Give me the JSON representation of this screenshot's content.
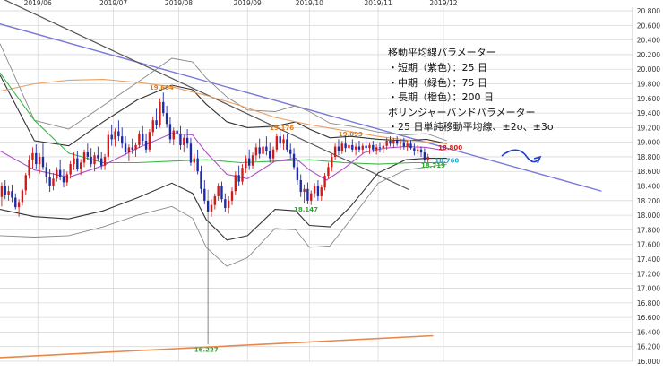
{
  "chart_data": {
    "type": "candlestick",
    "grid": true,
    "x_tick_labels": [
      "2019/06",
      "2019/07",
      "2019/08",
      "2019/09",
      "2019/10",
      "2019/11",
      "2019/12"
    ],
    "y_tick_labels": [
      "16.000",
      "16.200",
      "16.400",
      "16.600",
      "16.800",
      "17.000",
      "17.200",
      "17.400",
      "17.600",
      "17.800",
      "18.000",
      "18.200",
      "18.400",
      "18.600",
      "18.800",
      "19.000",
      "19.200",
      "19.400",
      "19.600",
      "19.800",
      "20.000",
      "20.200",
      "20.400",
      "20.600",
      "20.800"
    ],
    "ylim": [
      16.0,
      20.85
    ],
    "x_range": [
      0,
      184
    ],
    "colors": {
      "up": "#d11a1a",
      "down": "#1d2ba8",
      "sma25": "#b04fc8",
      "sma75": "#3cb84a",
      "sma200": "#e8a063",
      "bands": "#333333",
      "resistance_line": "#7b79d8",
      "steep_line": "#555555",
      "support_line": "#e8884a",
      "forecast_arrow": "#1d3fd0"
    },
    "annotation": {
      "lines": [
        "移動平均線パラメーター",
        "・短期（紫色）：25 日",
        "・中期（緑色）：75 日",
        "・長期（橙色）：200 日",
        "ボリンジャーバンドパラメーター",
        "・25 日単純移動平均線、±2σ、±3σ"
      ]
    },
    "price_labels": [
      {
        "text": "19.684",
        "x": 47,
        "y": 19.72,
        "color": "#e07b1a"
      },
      {
        "text": "19.176",
        "x": 82,
        "y": 19.17,
        "color": "#e07b1a"
      },
      {
        "text": "19.093",
        "x": 102,
        "y": 19.08,
        "color": "#e07b1a"
      },
      {
        "text": "18.147",
        "x": 89,
        "y": 18.05,
        "color": "#2fa52f"
      },
      {
        "text": "16.227",
        "x": 60,
        "y": 16.13,
        "color": "#2fa52f"
      },
      {
        "text": "18.719",
        "x": 126,
        "y": 18.65,
        "color": "#2fa52f"
      },
      {
        "text": "18.800",
        "x": 131,
        "y": 18.9,
        "color": "#d11a1a"
      },
      {
        "text": "18.760",
        "x": 130,
        "y": 18.72,
        "color": "#17a8c8"
      }
    ],
    "trendlines": [
      {
        "name": "resistance",
        "points": [
          [
            0,
            20.62
          ],
          [
            175,
            18.33
          ]
        ]
      },
      {
        "name": "steep",
        "points": [
          [
            0,
            20.98
          ],
          [
            119,
            18.35
          ]
        ]
      },
      {
        "name": "support",
        "points": [
          [
            0,
            16.05
          ],
          [
            126,
            16.35
          ]
        ]
      }
    ],
    "x_tick_positions": [
      11,
      33,
      52,
      72,
      90,
      110,
      129
    ],
    "candles": [
      [
        18.25,
        18.45,
        18.12,
        18.4
      ],
      [
        18.4,
        18.48,
        18.22,
        18.28
      ],
      [
        18.28,
        18.41,
        18.2,
        18.33
      ],
      [
        18.33,
        18.42,
        18.18,
        18.24
      ],
      [
        18.24,
        18.3,
        18.08,
        18.11
      ],
      [
        18.11,
        18.22,
        17.98,
        18.18
      ],
      [
        18.18,
        18.36,
        18.13,
        18.34
      ],
      [
        18.34,
        18.58,
        18.28,
        18.55
      ],
      [
        18.55,
        18.82,
        18.5,
        18.76
      ],
      [
        18.76,
        18.93,
        18.64,
        18.85
      ],
      [
        18.85,
        18.97,
        18.63,
        18.7
      ],
      [
        18.7,
        18.85,
        18.57,
        18.8
      ],
      [
        18.8,
        18.98,
        18.62,
        18.66
      ],
      [
        18.66,
        18.72,
        18.44,
        18.52
      ],
      [
        18.52,
        18.64,
        18.32,
        18.4
      ],
      [
        18.4,
        18.58,
        18.34,
        18.5
      ],
      [
        18.5,
        18.66,
        18.46,
        18.62
      ],
      [
        18.62,
        18.76,
        18.48,
        18.52
      ],
      [
        18.52,
        18.63,
        18.38,
        18.45
      ],
      [
        18.45,
        18.6,
        18.4,
        18.56
      ],
      [
        18.56,
        18.74,
        18.5,
        18.7
      ],
      [
        18.7,
        18.86,
        18.62,
        18.78
      ],
      [
        18.78,
        18.88,
        18.6,
        18.64
      ],
      [
        18.64,
        18.77,
        18.55,
        18.72
      ],
      [
        18.72,
        18.9,
        18.66,
        18.86
      ],
      [
        18.86,
        18.98,
        18.75,
        18.8
      ],
      [
        18.8,
        18.92,
        18.66,
        18.7
      ],
      [
        18.7,
        18.86,
        18.6,
        18.82
      ],
      [
        18.82,
        18.94,
        18.74,
        18.78
      ],
      [
        18.78,
        18.86,
        18.62,
        18.68
      ],
      [
        18.68,
        18.84,
        18.62,
        18.8
      ],
      [
        18.8,
        19.16,
        18.76,
        19.1
      ],
      [
        19.1,
        19.24,
        18.95,
        19.04
      ],
      [
        19.04,
        19.19,
        18.94,
        19.15
      ],
      [
        19.15,
        19.3,
        19.02,
        19.08
      ],
      [
        19.08,
        19.2,
        18.92,
        18.98
      ],
      [
        18.98,
        19.08,
        18.82,
        18.86
      ],
      [
        18.86,
        18.97,
        18.74,
        18.93
      ],
      [
        18.93,
        19.05,
        18.84,
        18.9
      ],
      [
        18.9,
        19.0,
        18.8,
        18.96
      ],
      [
        18.96,
        19.16,
        18.92,
        19.12
      ],
      [
        19.12,
        19.22,
        18.96,
        19.02
      ],
      [
        19.02,
        19.12,
        18.85,
        18.9
      ],
      [
        18.9,
        19.18,
        18.86,
        19.14
      ],
      [
        19.14,
        19.35,
        19.08,
        19.3
      ],
      [
        19.3,
        19.46,
        19.18,
        19.24
      ],
      [
        19.24,
        19.6,
        19.2,
        19.55
      ],
      [
        19.55,
        19.68,
        19.36,
        19.4
      ],
      [
        19.4,
        19.5,
        19.2,
        19.25
      ],
      [
        19.25,
        19.34,
        18.98,
        19.04
      ],
      [
        19.04,
        19.2,
        18.96,
        19.16
      ],
      [
        19.16,
        19.3,
        19.06,
        19.12
      ],
      [
        19.12,
        19.22,
        18.9,
        18.96
      ],
      [
        18.96,
        19.1,
        18.86,
        19.06
      ],
      [
        19.06,
        19.18,
        18.92,
        18.98
      ],
      [
        18.98,
        19.06,
        18.68,
        18.72
      ],
      [
        18.72,
        18.84,
        18.6,
        18.78
      ],
      [
        18.78,
        18.9,
        18.56,
        18.6
      ],
      [
        18.6,
        18.68,
        18.3,
        18.36
      ],
      [
        18.36,
        18.48,
        18.15,
        18.2
      ],
      [
        18.2,
        18.35,
        16.23,
        18.05
      ],
      [
        18.05,
        18.22,
        17.98,
        18.14
      ],
      [
        18.14,
        18.3,
        18.08,
        18.26
      ],
      [
        18.26,
        18.44,
        18.2,
        18.4
      ],
      [
        18.4,
        18.46,
        18.18,
        18.22
      ],
      [
        18.22,
        18.3,
        18.05,
        18.1
      ],
      [
        18.1,
        18.26,
        18.02,
        18.2
      ],
      [
        18.2,
        18.38,
        18.14,
        18.33
      ],
      [
        18.33,
        18.6,
        18.28,
        18.55
      ],
      [
        18.55,
        18.68,
        18.4,
        18.46
      ],
      [
        18.46,
        18.7,
        18.42,
        18.65
      ],
      [
        18.65,
        18.82,
        18.58,
        18.78
      ],
      [
        18.78,
        18.9,
        18.62,
        18.68
      ],
      [
        18.68,
        18.86,
        18.64,
        18.82
      ],
      [
        18.82,
        18.98,
        18.74,
        18.93
      ],
      [
        18.93,
        19.05,
        18.78,
        18.84
      ],
      [
        18.84,
        18.98,
        18.76,
        18.94
      ],
      [
        18.94,
        19.08,
        18.82,
        18.88
      ],
      [
        18.88,
        19.0,
        18.72,
        18.78
      ],
      [
        18.78,
        18.94,
        18.72,
        18.9
      ],
      [
        18.9,
        19.12,
        18.86,
        19.08
      ],
      [
        19.08,
        19.18,
        18.92,
        18.98
      ],
      [
        18.98,
        19.1,
        18.9,
        19.04
      ],
      [
        19.04,
        19.12,
        18.86,
        18.9
      ],
      [
        18.9,
        18.98,
        18.78,
        18.84
      ],
      [
        18.84,
        18.92,
        18.62,
        18.66
      ],
      [
        18.66,
        18.76,
        18.42,
        18.48
      ],
      [
        18.48,
        18.56,
        18.25,
        18.32
      ],
      [
        18.32,
        18.42,
        18.16,
        18.36
      ],
      [
        18.36,
        18.45,
        18.15,
        18.2
      ],
      [
        18.2,
        18.34,
        18.14,
        18.3
      ],
      [
        18.3,
        18.44,
        18.24,
        18.4
      ],
      [
        18.4,
        18.48,
        18.2,
        18.26
      ],
      [
        18.26,
        18.42,
        18.2,
        18.38
      ],
      [
        18.38,
        18.58,
        18.34,
        18.54
      ],
      [
        18.54,
        18.72,
        18.5,
        18.66
      ],
      [
        18.66,
        18.84,
        18.6,
        18.8
      ],
      [
        18.8,
        18.98,
        18.76,
        18.94
      ],
      [
        18.94,
        19.04,
        18.82,
        18.88
      ],
      [
        18.88,
        19.02,
        18.84,
        18.98
      ],
      [
        18.98,
        19.09,
        18.86,
        18.92
      ],
      [
        18.92,
        19.02,
        18.84,
        18.96
      ],
      [
        18.96,
        19.04,
        18.86,
        18.9
      ],
      [
        18.9,
        18.98,
        18.82,
        18.94
      ],
      [
        18.94,
        19.02,
        18.86,
        18.9
      ],
      [
        18.9,
        18.98,
        18.84,
        18.95
      ],
      [
        18.95,
        19.03,
        18.88,
        18.92
      ],
      [
        18.92,
        19.0,
        18.84,
        18.96
      ],
      [
        18.96,
        19.02,
        18.86,
        18.9
      ],
      [
        18.9,
        18.97,
        18.83,
        18.93
      ],
      [
        18.93,
        19.0,
        18.86,
        18.92
      ],
      [
        18.92,
        18.98,
        18.85,
        18.95
      ],
      [
        18.95,
        19.06,
        18.9,
        19.02
      ],
      [
        19.02,
        19.08,
        18.94,
        18.98
      ],
      [
        18.98,
        19.06,
        18.92,
        19.03
      ],
      [
        19.03,
        19.08,
        18.95,
        18.98
      ],
      [
        18.98,
        19.05,
        18.9,
        19.0
      ],
      [
        19.0,
        19.06,
        18.9,
        18.94
      ],
      [
        18.94,
        19.02,
        18.88,
        18.98
      ],
      [
        18.98,
        19.03,
        18.9,
        18.92
      ],
      [
        18.92,
        18.98,
        18.82,
        18.88
      ],
      [
        18.88,
        18.96,
        18.84,
        18.9
      ],
      [
        18.9,
        18.94,
        18.8,
        18.86
      ],
      [
        18.86,
        18.92,
        18.72,
        18.76
      ],
      [
        18.76,
        18.84,
        18.72,
        18.8
      ]
    ],
    "sma25": [
      [
        0,
        18.88
      ],
      [
        10,
        18.62
      ],
      [
        20,
        18.52
      ],
      [
        30,
        18.68
      ],
      [
        40,
        18.92
      ],
      [
        50,
        19.12
      ],
      [
        56,
        19.1
      ],
      [
        60,
        18.86
      ],
      [
        66,
        18.56
      ],
      [
        72,
        18.5
      ],
      [
        80,
        18.74
      ],
      [
        86,
        18.78
      ],
      [
        90,
        18.62
      ],
      [
        95,
        18.48
      ],
      [
        100,
        18.64
      ],
      [
        106,
        18.86
      ],
      [
        112,
        18.92
      ],
      [
        118,
        18.94
      ],
      [
        124,
        18.93
      ],
      [
        130,
        18.88
      ]
    ],
    "sma75": [
      [
        0,
        19.95
      ],
      [
        10,
        19.3
      ],
      [
        20,
        18.85
      ],
      [
        30,
        18.72
      ],
      [
        40,
        18.72
      ],
      [
        50,
        18.74
      ],
      [
        60,
        18.76
      ],
      [
        70,
        18.72
      ],
      [
        80,
        18.74
      ],
      [
        90,
        18.76
      ],
      [
        100,
        18.72
      ],
      [
        110,
        18.7
      ],
      [
        120,
        18.72
      ],
      [
        130,
        18.72
      ]
    ],
    "sma200": [
      [
        0,
        19.7
      ],
      [
        10,
        19.8
      ],
      [
        20,
        19.85
      ],
      [
        30,
        19.86
      ],
      [
        40,
        19.82
      ],
      [
        50,
        19.76
      ],
      [
        60,
        19.64
      ],
      [
        70,
        19.5
      ],
      [
        80,
        19.34
      ],
      [
        90,
        19.24
      ],
      [
        100,
        19.16
      ],
      [
        110,
        19.08
      ],
      [
        120,
        19.02
      ],
      [
        130,
        18.98
      ]
    ],
    "bands": {
      "upper3": [
        [
          0,
          20.35
        ],
        [
          10,
          19.3
        ],
        [
          20,
          19.18
        ],
        [
          30,
          19.5
        ],
        [
          40,
          19.82
        ],
        [
          50,
          20.15
        ],
        [
          56,
          20.1
        ],
        [
          60,
          19.88
        ],
        [
          66,
          19.62
        ],
        [
          72,
          19.44
        ],
        [
          80,
          19.42
        ],
        [
          86,
          19.5
        ],
        [
          90,
          19.42
        ],
        [
          96,
          19.26
        ],
        [
          102,
          19.22
        ],
        [
          110,
          19.14
        ],
        [
          118,
          19.1
        ],
        [
          124,
          19.12
        ],
        [
          130,
          19.02
        ]
      ],
      "upper2": [
        [
          0,
          19.92
        ],
        [
          10,
          19.02
        ],
        [
          20,
          18.95
        ],
        [
          30,
          19.28
        ],
        [
          40,
          19.58
        ],
        [
          50,
          19.78
        ],
        [
          56,
          19.72
        ],
        [
          60,
          19.52
        ],
        [
          66,
          19.28
        ],
        [
          72,
          19.2
        ],
        [
          80,
          19.22
        ],
        [
          86,
          19.28
        ],
        [
          90,
          19.18
        ],
        [
          96,
          19.06
        ],
        [
          102,
          19.08
        ],
        [
          110,
          19.04
        ],
        [
          118,
          19.02
        ],
        [
          124,
          19.04
        ],
        [
          130,
          18.98
        ]
      ],
      "lower2": [
        [
          0,
          18.08
        ],
        [
          10,
          17.98
        ],
        [
          20,
          17.95
        ],
        [
          30,
          18.06
        ],
        [
          40,
          18.24
        ],
        [
          50,
          18.44
        ],
        [
          56,
          18.3
        ],
        [
          60,
          17.94
        ],
        [
          66,
          17.66
        ],
        [
          72,
          17.72
        ],
        [
          80,
          18.08
        ],
        [
          86,
          18.06
        ],
        [
          90,
          17.86
        ],
        [
          96,
          17.84
        ],
        [
          102,
          18.12
        ],
        [
          110,
          18.58
        ],
        [
          118,
          18.76
        ],
        [
          124,
          18.78
        ],
        [
          130,
          18.78
        ]
      ],
      "lower3": [
        [
          0,
          17.72
        ],
        [
          10,
          17.7
        ],
        [
          20,
          17.72
        ],
        [
          30,
          17.84
        ],
        [
          40,
          18.0
        ],
        [
          50,
          18.12
        ],
        [
          56,
          17.96
        ],
        [
          60,
          17.56
        ],
        [
          66,
          17.3
        ],
        [
          72,
          17.42
        ],
        [
          80,
          17.82
        ],
        [
          86,
          17.8
        ],
        [
          90,
          17.56
        ],
        [
          96,
          17.58
        ],
        [
          102,
          17.94
        ],
        [
          110,
          18.44
        ],
        [
          118,
          18.62
        ],
        [
          124,
          18.66
        ],
        [
          130,
          18.7
        ]
      ]
    }
  }
}
